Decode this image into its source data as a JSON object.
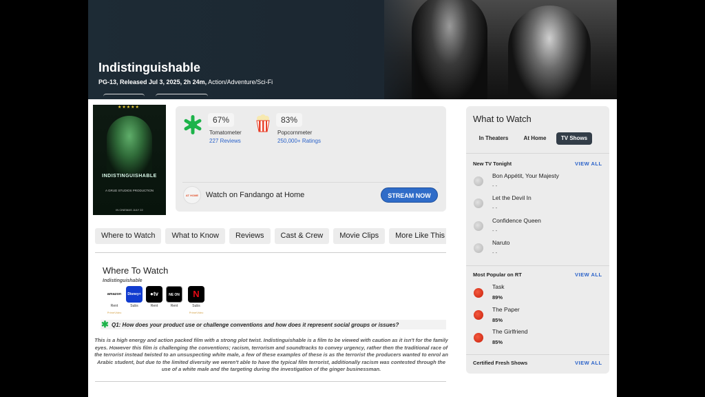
{
  "hero": {
    "title": "Indistinguishable",
    "rating_release": "PG-13, Released Jul 3, 2025, 2h 24m,",
    "genre": "Action/Adventure/Sci-Fi"
  },
  "poster": {
    "stars": "★★★★★",
    "title": "INDISTINGUISHABLE",
    "studio": "A GRUD STUDIOS PRODUCTION",
    "release": "IN CINEMAS JULY 22"
  },
  "scores": {
    "tomatometer": {
      "value": "67%",
      "label": "Tomatometer",
      "link": "227 Reviews"
    },
    "popcornmeter": {
      "value": "83%",
      "label": "Popcornmeter",
      "link": "250,000+ Ratings"
    }
  },
  "stream": {
    "icon_text": "AT HOME",
    "text": "Watch on Fandango at Home",
    "button": "STREAM NOW"
  },
  "tabs": [
    "Where to Watch",
    "What to Know",
    "Reviews",
    "Cast & Crew",
    "Movie Clips",
    "More Like This"
  ],
  "where_to_watch": {
    "title": "Where To Watch",
    "subtitle": "Indistinguishable",
    "services": [
      {
        "name": "amazon",
        "type": "Rent",
        "extra": "PrimeVideo",
        "color": "#ffffff"
      },
      {
        "name": "Disney+",
        "type": "Subs",
        "extra": "",
        "color": "#113ccf"
      },
      {
        "name": "tv",
        "type": "Rent",
        "extra": "",
        "color": "#000000"
      },
      {
        "name": "NE ON",
        "type": "Rent",
        "extra": "",
        "color": "#000000"
      },
      {
        "name": "N",
        "type": "Subs",
        "extra": "PrimeVideo",
        "color": "#000000"
      }
    ],
    "question": "Q1: How does your product use or challenge conventions and how does it represent social groups or issues?",
    "answer": "This is a high energy and action packed film with a strong plot twist. Indistinguishable is a film to be viewed with caution as it isn't for the family eyes. However this film is challenging the conventions; racism, terrorism and soundtracks to convey urgency, rather then the traditional race of the terrorist instead twisted to an unsuspecting white male, a few of these examples of these is as the terrorist the producers wanted to enrol an Arabic student, but due to the limited diversity we weren't able to have the typical film terrorist, additionally racism was contested  through the use of a white male and the targeting during the investigation of the ginger businessman."
  },
  "side": {
    "title": "What to Watch",
    "tabs": [
      "In Theaters",
      "At Home",
      "TV Shows"
    ],
    "new_tv": {
      "heading": "New TV Tonight",
      "view_all": "VIEW ALL",
      "items": [
        {
          "title": "Bon Appétit, Your Majesty",
          "score": "- -"
        },
        {
          "title": "Let the Devil In",
          "score": "- -"
        },
        {
          "title": "Confidence Queen",
          "score": "- -"
        },
        {
          "title": "Naruto",
          "score": "- -"
        }
      ]
    },
    "popular": {
      "heading": "Most Popular on RT",
      "view_all": "VIEW ALL",
      "items": [
        {
          "title": "Task",
          "score": "89%"
        },
        {
          "title": "The Paper",
          "score": "85%"
        },
        {
          "title": "The Girlfriend",
          "score": "85%"
        }
      ]
    },
    "certified": {
      "heading": "Certified Fresh Shows",
      "view_all": "VIEW ALL"
    }
  },
  "colors": {
    "accent": "#2a62c9",
    "stream_button": "#2f6cc8",
    "splat": "#1db34a",
    "active_tab": "#333d48"
  }
}
